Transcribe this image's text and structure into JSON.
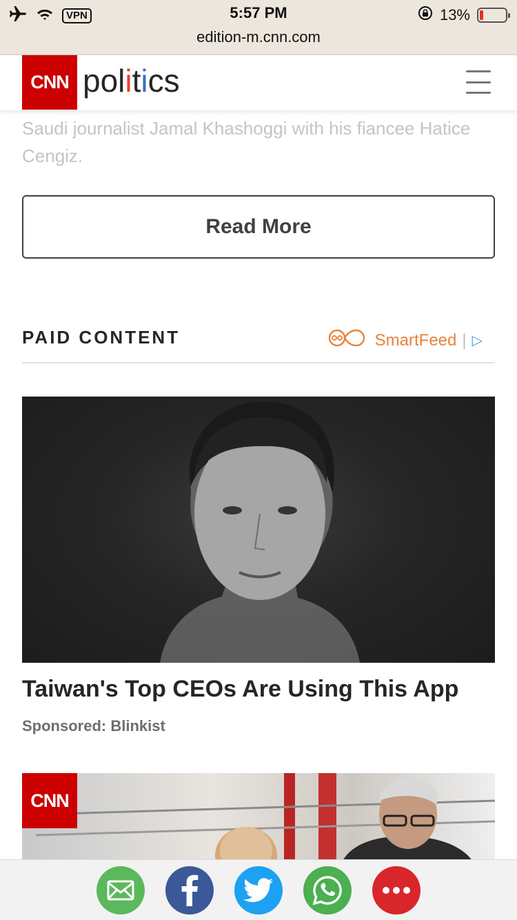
{
  "status_bar": {
    "vpn_label": "VPN",
    "time": "5:57 PM",
    "url": "edition-m.cnn.com",
    "battery_percent": "13%",
    "battery_level": 0.13,
    "icons": [
      "airplane-mode-icon",
      "wifi-icon",
      "rotation-lock-icon",
      "battery-icon"
    ]
  },
  "header": {
    "logo_text": "CNN",
    "section_p1": "pol",
    "section_i1": "i",
    "section_p2": "t",
    "section_i2": "i",
    "section_p3": "cs",
    "menu_icon": "hamburger-menu-icon"
  },
  "article": {
    "caption": "Saudi journalist Jamal Khashoggi with his fiancee Hatice Cengiz.",
    "read_more_label": "Read More"
  },
  "paid_content": {
    "heading": "PAID CONTENT",
    "provider": "SmartFeed",
    "provider_separator": "|",
    "items": [
      {
        "title": "Taiwan's Top CEOs Are Using This App",
        "sponsor": "Sponsored: Blinkist"
      },
      {
        "logo_text": "CNN"
      }
    ]
  },
  "share_bar": {
    "buttons": [
      {
        "name": "email-share-icon",
        "color": "#5cb85c"
      },
      {
        "name": "facebook-share-icon",
        "color": "#3b5998"
      },
      {
        "name": "twitter-share-icon",
        "color": "#1da1f2"
      },
      {
        "name": "whatsapp-share-icon",
        "color": "#4caf50"
      },
      {
        "name": "more-share-icon",
        "color": "#d9262b"
      }
    ]
  },
  "colors": {
    "cnn_red": "#cc0000",
    "smartfeed_orange": "#e8833a"
  }
}
